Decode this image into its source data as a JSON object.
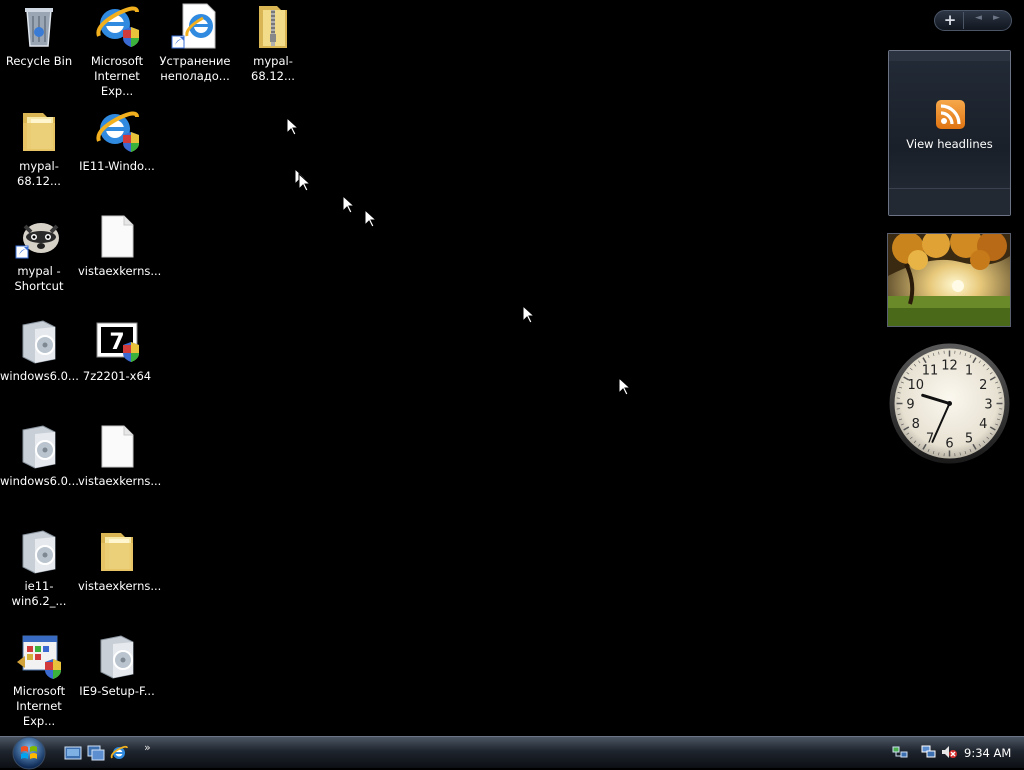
{
  "desktop": {
    "icons": [
      {
        "label": "Recycle Bin",
        "icon": "recycle-bin-icon"
      },
      {
        "label": "Microsoft\nInternet Exp...",
        "icon": "internet-explorer-icon"
      },
      {
        "label": "Устранение\nнеполадо...",
        "icon": "troubleshooter-shortcut-icon"
      },
      {
        "label": "mypal-68.12...",
        "icon": "zip-folder-icon"
      },
      {
        "label": "mypal-68.12...",
        "icon": "folder-icon"
      },
      {
        "label": "IE11-Windo...",
        "icon": "internet-explorer-icon"
      },
      {
        "label": "mypal -\nShortcut",
        "icon": "mypal-raccoon-icon"
      },
      {
        "label": "vistaexkerns...",
        "icon": "blank-file-icon"
      },
      {
        "label": "windows6.0...",
        "icon": "update-package-icon"
      },
      {
        "label": "7z2201-x64",
        "icon": "7zip-installer-icon"
      },
      {
        "label": "windows6.0...",
        "icon": "update-package-icon"
      },
      {
        "label": "vistaexkerns...",
        "icon": "blank-file-icon"
      },
      {
        "label": "ie11-win6.2_...",
        "icon": "update-package-icon"
      },
      {
        "label": "vistaexkerns...",
        "icon": "folder-icon"
      },
      {
        "label": "Microsoft\nInternet Exp...",
        "icon": "ie-setup-icon"
      },
      {
        "label": "IE9-Setup-F...",
        "icon": "update-package-icon"
      }
    ]
  },
  "sidebar": {
    "add_gadget": "+",
    "prev": "◄",
    "next": "►",
    "feed_gadget": {
      "label": "View headlines",
      "icon": "rss-icon"
    },
    "slideshow": {
      "icon": "autumn-tree-photo"
    },
    "clock": {
      "icon": "analog-clock",
      "hour": 9,
      "minute": 34,
      "numbers": [
        "1",
        "2",
        "3",
        "4",
        "5",
        "6",
        "7",
        "8",
        "9",
        "10",
        "11",
        "12"
      ]
    }
  },
  "taskbar": {
    "start_icon": "windows-orb-icon",
    "quick_launch": [
      "show-desktop-icon",
      "switch-windows-icon",
      "internet-explorer-icon"
    ],
    "overflow": "»",
    "tray_icons": [
      "network-icon",
      "connection-icon",
      "volume-muted-icon"
    ],
    "time": "9:34 AM"
  },
  "colors": {
    "desktop": "#000000",
    "rss": "#F08A24",
    "taskbar": "#1f252e"
  }
}
